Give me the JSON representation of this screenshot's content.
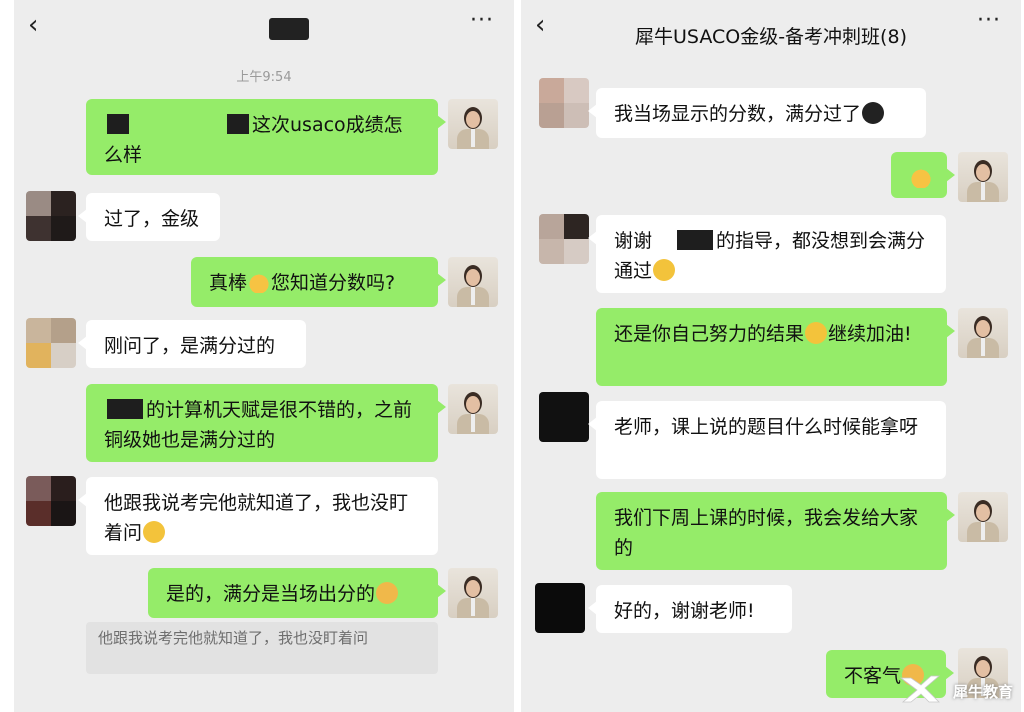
{
  "left": {
    "title": "",
    "timestamp": "上午9:54",
    "messages": [
      {
        "text": "这次usaco成绩怎么样"
      },
      {
        "text": "过了，金级"
      },
      {
        "text_a": "真棒",
        "text_b": "您知道分数吗?"
      },
      {
        "text": "刚问了，是满分过的"
      },
      {
        "text": "的计算机天赋是很不错的，之前铜级她也是满分过的"
      },
      {
        "text": "他跟我说考完他就知道了，我也没盯着问"
      },
      {
        "text": "是的，满分是当场出分的"
      }
    ],
    "quote": "他跟我说考完他就知道了，我也没盯着问"
  },
  "right": {
    "title": "犀牛USACO金级-备考冲刺班(8)",
    "messages": [
      {
        "text": "我当场显示的分数，满分过了"
      },
      {
        "text": ""
      },
      {
        "text_a": "谢谢",
        "text_b": "的指导，都没想到会满分通过"
      },
      {
        "text_a": "还是你自己努力的结果",
        "text_b": "继续加油!"
      },
      {
        "text": "老师，课上说的题目什么时候能拿呀"
      },
      {
        "text": "我们下周上课的时候，我会发给大家的"
      },
      {
        "text": "好的，谢谢老师!"
      },
      {
        "text": "不客气"
      }
    ]
  },
  "icons": {
    "back": "‹",
    "more": "···"
  },
  "watermark": "犀牛教育",
  "colors": {
    "self_bubble": "#95ec69",
    "other_bubble": "#ffffff",
    "background": "#ededed"
  }
}
